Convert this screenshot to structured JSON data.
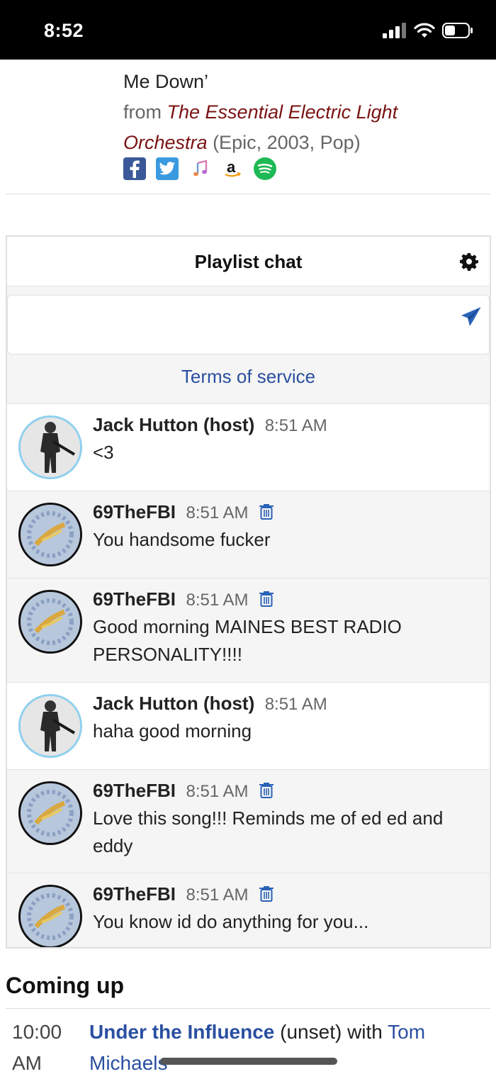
{
  "status_bar": {
    "time": "8:52"
  },
  "now_playing": {
    "title_tail": "Me Down’",
    "from_label": "from",
    "album": "The Essential Electric Light Orchestra",
    "meta": "(Epic, 2003, Pop)",
    "services": [
      "facebook-icon",
      "twitter-icon",
      "apple-music-icon",
      "amazon-icon",
      "spotify-icon"
    ]
  },
  "chat": {
    "title": "Playlist chat",
    "input_value": "",
    "terms_label": "Terms of service",
    "messages": [
      {
        "name": "Jack Hutton (host)",
        "time": "8:51 AM",
        "text": "<3",
        "role": "host"
      },
      {
        "name": "69TheFBI",
        "time": "8:51 AM",
        "text": "You handsome fucker",
        "role": "guest"
      },
      {
        "name": "69TheFBI",
        "time": "8:51 AM",
        "text": "Good morning MAINES BEST RADIO PERSONALITY!!!!",
        "role": "guest"
      },
      {
        "name": "Jack Hutton (host)",
        "time": "8:51 AM",
        "text": "haha good morning",
        "role": "host"
      },
      {
        "name": "69TheFBI",
        "time": "8:51 AM",
        "text": "Love this song!!! Reminds me of ed ed and eddy",
        "role": "guest"
      },
      {
        "name": "69TheFBI",
        "time": "8:51 AM",
        "text": "You know id do anything for you...",
        "role": "guest"
      }
    ]
  },
  "coming_up": {
    "heading": "Coming up",
    "time": "10:00 AM",
    "show": "Under the Influence",
    "unset": "(unset) with",
    "host": "Tom Michaels"
  },
  "colors": {
    "link": "#2a4fa1",
    "album": "#7a1212",
    "status_bar": "#000000"
  }
}
